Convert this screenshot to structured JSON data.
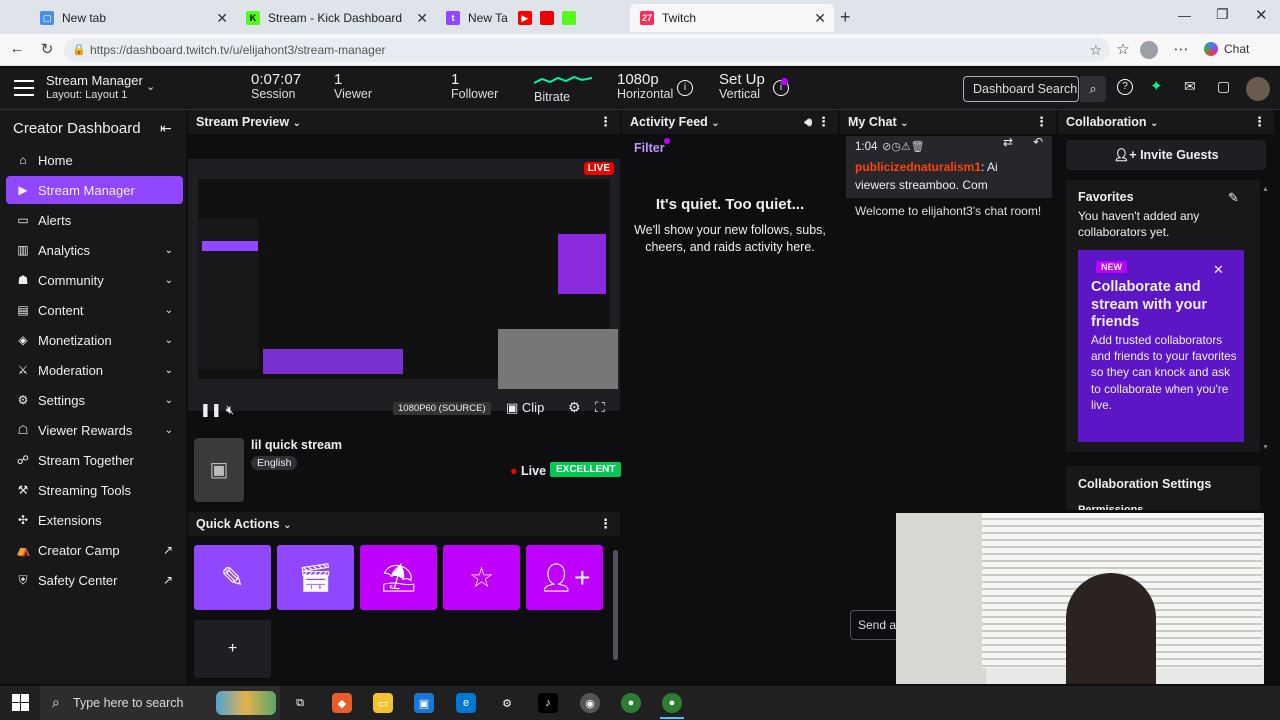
{
  "browser": {
    "tabs": [
      {
        "label": "New tab",
        "active": false
      },
      {
        "label": "Stream - Kick Dashboard",
        "active": false
      },
      {
        "label": "New Ta",
        "active": false
      },
      {
        "label": "Twitch",
        "active": true
      }
    ],
    "url": "https://dashboard.twitch.tv/u/elijahont3/stream-manager",
    "chat_label": "Chat"
  },
  "topbar": {
    "title": "Stream Manager",
    "layout": "Layout: Layout 1",
    "session_value": "0:07:07",
    "session_label": "Session",
    "viewer_value": "1",
    "viewer_label": "Viewer",
    "follower_value": "1",
    "follower_label": "Follower",
    "bitrate_label": "Bitrate",
    "res_value": "1080p",
    "res_label": "Horizontal",
    "setup_value": "Set Up",
    "setup_label": "Vertical",
    "search_placeholder": "Dashboard Search"
  },
  "sidebar": {
    "title": "Creator Dashboard",
    "items": [
      {
        "label": "Home",
        "icon": "home-icon"
      },
      {
        "label": "Stream Manager",
        "icon": "stream-icon"
      },
      {
        "label": "Alerts",
        "icon": "alert-icon"
      },
      {
        "label": "Analytics",
        "icon": "analytics-icon"
      },
      {
        "label": "Community",
        "icon": "community-icon"
      },
      {
        "label": "Content",
        "icon": "content-icon"
      },
      {
        "label": "Monetization",
        "icon": "money-icon"
      },
      {
        "label": "Moderation",
        "icon": "sword-icon"
      },
      {
        "label": "Settings",
        "icon": "gear-icon"
      },
      {
        "label": "Viewer Rewards",
        "icon": "gift-icon"
      },
      {
        "label": "Stream Together",
        "icon": "users-icon"
      },
      {
        "label": "Streaming Tools",
        "icon": "tools-icon"
      },
      {
        "label": "Extensions",
        "icon": "puzzle-icon"
      },
      {
        "label": "Creator Camp",
        "icon": "camp-icon"
      },
      {
        "label": "Safety Center",
        "icon": "shield-icon"
      }
    ]
  },
  "preview": {
    "title": "Stream Preview",
    "live_badge": "LIVE",
    "source": "1080P60 (SOURCE)",
    "clip": "Clip",
    "stream_title": "lil quick stream",
    "language": "English",
    "status": "Live",
    "quality": "EXCELLENT"
  },
  "quick_actions": {
    "title": "Quick Actions",
    "add": "+"
  },
  "activity": {
    "title": "Activity Feed",
    "filter": "Filter",
    "empty_title": "It's quiet. Too quiet...",
    "empty_body": "We'll show your new follows, subs, cheers, and raids activity here."
  },
  "chat": {
    "title": "My Chat",
    "time": "1:04",
    "username": "publicizednaturalism1",
    "message": ": Ai viewers streamboo. Com",
    "welcome": "Welcome to elijahont3's chat room!",
    "send_placeholder": "Send a"
  },
  "collab": {
    "title": "Collaboration",
    "invite": "Invite Guests",
    "favorites_title": "Favorites",
    "favorites_empty": "You haven't added any collaborators yet.",
    "new_badge": "NEW",
    "promo_title": "Collaborate and stream with your friends",
    "promo_body": "Add trusted collaborators and friends to your favorites so they can knock and ask to collaborate when you're live.",
    "settings_title": "Collaboration Settings",
    "permissions": "Permissions"
  },
  "taskbar": {
    "search_placeholder": "Type here to search"
  },
  "colors": {
    "accent": "#9147ff",
    "live": "#eb0400",
    "excellent": "#00c853",
    "magenta": "#bf00ff"
  }
}
